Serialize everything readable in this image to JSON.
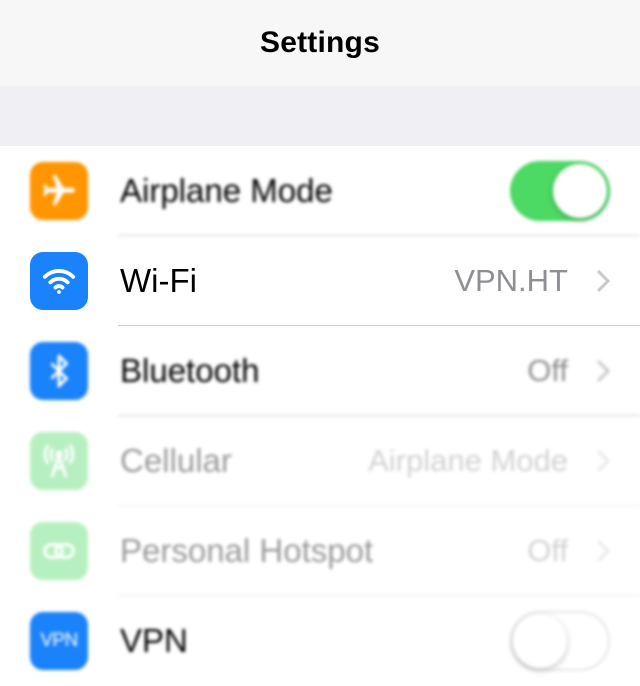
{
  "navbar": {
    "title": "Settings"
  },
  "rows": [
    {
      "label": "Airplane Mode",
      "icon": "airplane-icon",
      "icon_color": "#ff9500",
      "toggle": "on"
    },
    {
      "label": "Wi-Fi",
      "icon": "wifi-icon",
      "icon_color": "#1a82fb",
      "value": "VPN.HT"
    },
    {
      "label": "Bluetooth",
      "icon": "bluetooth-icon",
      "icon_color": "#1a82fb",
      "value": "Off"
    },
    {
      "label": "Cellular",
      "icon": "cellular-antenna-icon",
      "icon_color": "#4cd964",
      "value": "Airplane Mode",
      "disabled": true
    },
    {
      "label": "Personal Hotspot",
      "icon": "hotspot-link-icon",
      "icon_color": "#4cd964",
      "value": "Off",
      "disabled": true
    },
    {
      "label": "VPN",
      "icon": "vpn-icon",
      "icon_color": "#1a82fb",
      "icon_text": "VPN",
      "toggle": "off"
    }
  ]
}
